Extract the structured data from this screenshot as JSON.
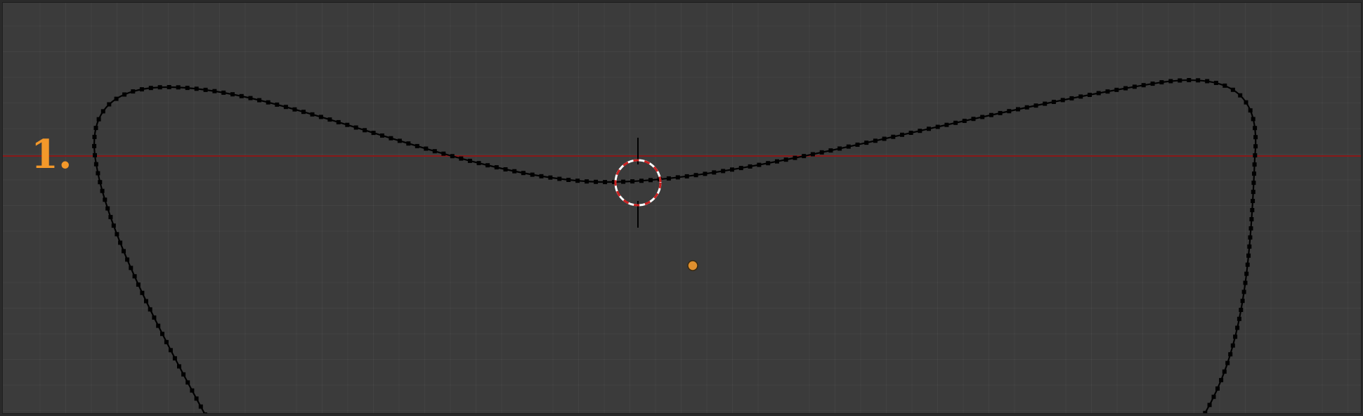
{
  "annotation": {
    "step_label": "1.",
    "color": "#f3982a"
  },
  "viewport": {
    "background": "#3b3b3b",
    "x_axis_color": "#8a1a1a",
    "curve_color": "#000000",
    "origin_color": "#e0902e"
  },
  "icons": {
    "cursor": "3d-cursor-icon",
    "origin": "object-origin-icon"
  }
}
